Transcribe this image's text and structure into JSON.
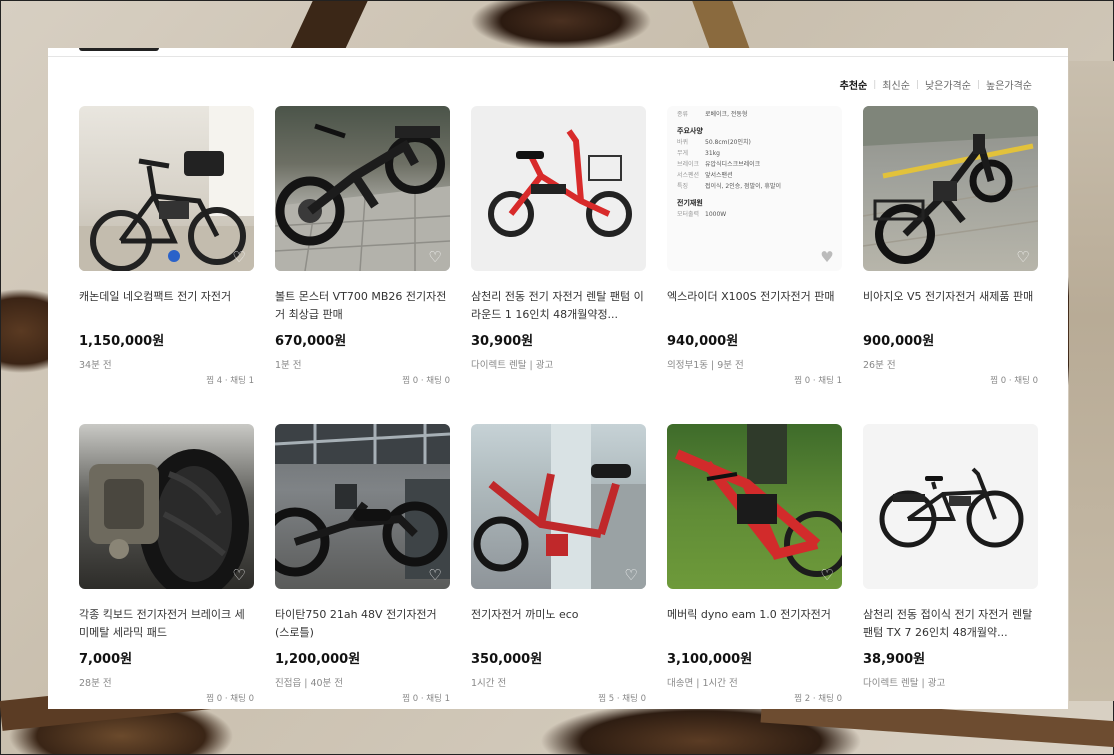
{
  "sort": {
    "options": [
      "추천순",
      "최신순",
      "낮은가격순",
      "높은가격순"
    ],
    "active": "추천순"
  },
  "products": [
    {
      "title": "캐논데일 네오컴팩트 전기 자전거",
      "price": "1,150,000원",
      "meta": "34분 전",
      "stats": "찜 4 · 채팅 1"
    },
    {
      "title": "볼트 몬스터 VT700 MB26 전기자전거 최상급 판매",
      "price": "670,000원",
      "meta": "1분 전",
      "stats": "찜 0 · 채팅 0"
    },
    {
      "title": "삼천리 전동 전기 자전거 렌탈 팬텀 이라운드 1 16인치 48개월약정...",
      "price": "30,900원",
      "meta": "다이렉트 렌탈 | 광고",
      "stats": ""
    },
    {
      "title": "엑스라이더 X100S 전기자전거 판매",
      "price": "940,000원",
      "meta": "의정부1동 | 9분 전",
      "stats": "찜 0 · 채팅 1"
    },
    {
      "title": "비아지오 V5 전기자전거 새제품 판매",
      "price": "900,000원",
      "meta": "26분 전",
      "stats": "찜 0 · 채팅 0"
    },
    {
      "title": "각종 킥보드 전기자전거 브레이크 세미메탈 세라믹 패드",
      "price": "7,000원",
      "meta": "28분 전",
      "stats": "찜 0 · 채팅 0"
    },
    {
      "title": "타이탄750 21ah 48V 전기자전거(스로틀)",
      "price": "1,200,000원",
      "meta": "진접읍 | 40분 전",
      "stats": "찜 0 · 채팅 1"
    },
    {
      "title": "전기자전거 까미노 eco",
      "price": "350,000원",
      "meta": "1시간 전",
      "stats": "찜 5 · 채팅 0"
    },
    {
      "title": "메버릭 dyno eam 1.0 전기자전거",
      "price": "3,100,000원",
      "meta": "대송면 | 1시간 전",
      "stats": "찜 2 · 채팅 0"
    },
    {
      "title": "삼천리 전동 접이식 전기 자전거 렌탈 팬텀 TX 7 26인치 48개월약...",
      "price": "38,900원",
      "meta": "다이렉트 렌탈 | 광고",
      "stats": ""
    }
  ],
  "spec_sheet": {
    "row0": {
      "k": "종류",
      "v": "로베이크, 전동형"
    },
    "heading1": "주요사양",
    "rows": [
      {
        "k": "바퀴",
        "v": "50.8cm(20인치)"
      },
      {
        "k": "무게",
        "v": "31kg"
      },
      {
        "k": "브레이크",
        "v": "유압식디스크브레이크"
      },
      {
        "k": "서스펜션",
        "v": "앞서스팬션"
      },
      {
        "k": "특징",
        "v": "접이식, 2인승, 점발이, 휴발이"
      }
    ],
    "heading2": "전기재원",
    "motor": {
      "k": "모터출력",
      "v": "1000W"
    }
  },
  "icons": {
    "heart": "heart-icon"
  }
}
